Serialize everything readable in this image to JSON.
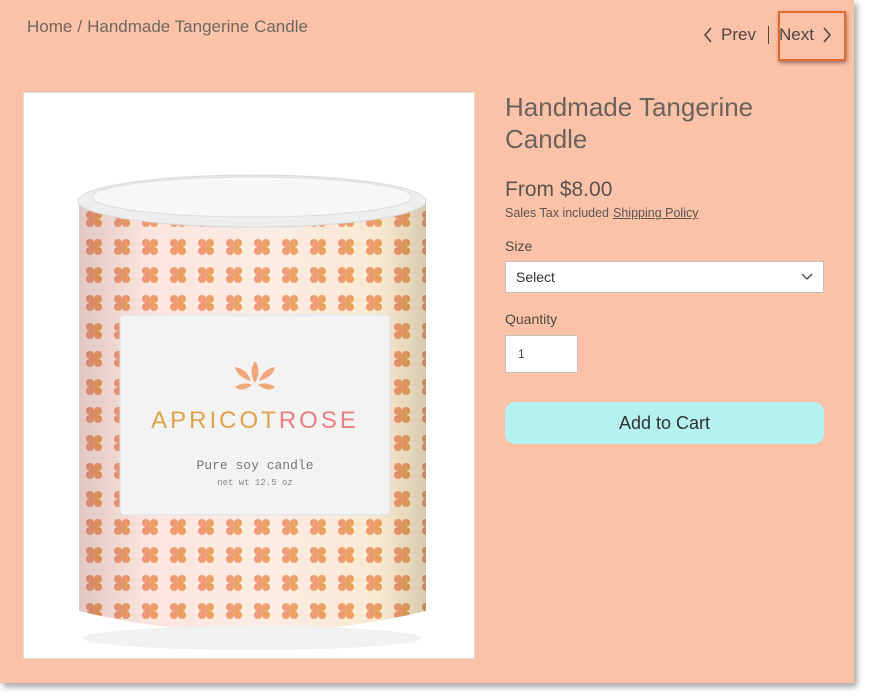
{
  "breadcrumb": {
    "home": "Home",
    "separator": "/",
    "current": "Handmade Tangerine Candle"
  },
  "nav": {
    "prev_label": "Prev",
    "next_label": "Next"
  },
  "product": {
    "title": "Handmade Tangerine Candle",
    "price": "From $8.00",
    "tax_text": "Sales Tax included",
    "shipping_link": "Shipping Policy",
    "image": {
      "brand_part1": "APRICOT",
      "brand_part2": "ROSE",
      "tagline": "Pure soy candle",
      "weight": "net wt 12.5 oz"
    }
  },
  "form": {
    "size_label": "Size",
    "size_selected": "Select",
    "quantity_label": "Quantity",
    "quantity_value": "1",
    "add_to_cart": "Add to Cart"
  },
  "colors": {
    "page_background": "#fcc2a8",
    "button_background": "#b3f2f0",
    "highlight_border": "#e06a2a"
  }
}
